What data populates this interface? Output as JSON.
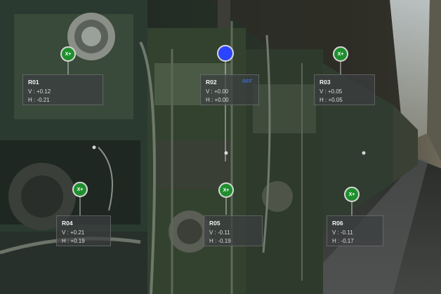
{
  "markers": [
    {
      "id": "R01",
      "add_label": "X+"
    },
    {
      "id": "R02",
      "add_label": ""
    },
    {
      "id": "R03",
      "add_label": "X+"
    },
    {
      "id": "R04",
      "add_label": "X+"
    },
    {
      "id": "R05",
      "add_label": "X+"
    },
    {
      "id": "R06",
      "add_label": "X+"
    }
  ],
  "labels": [
    {
      "id": "R01",
      "v": "V : +0.12",
      "h": "H : -0.21"
    },
    {
      "id": "R02",
      "v": "V : +0.00",
      "h": "H : +0.00",
      "ref": "REF"
    },
    {
      "id": "R03",
      "v": "V : +0.05",
      "h": "H : +0.05"
    },
    {
      "id": "R04",
      "v": "V : +0.21",
      "h": "H : +0.19"
    },
    {
      "id": "R05",
      "v": "V : -0.11",
      "h": "H : -0.19"
    },
    {
      "id": "R06",
      "v": "V : -0.11",
      "h": "H : -0.17"
    }
  ],
  "colors": {
    "marker_fill": "#1f8f2e",
    "reference_marker_fill": "#2b44ff",
    "ref_tag": "#3b7cff"
  }
}
